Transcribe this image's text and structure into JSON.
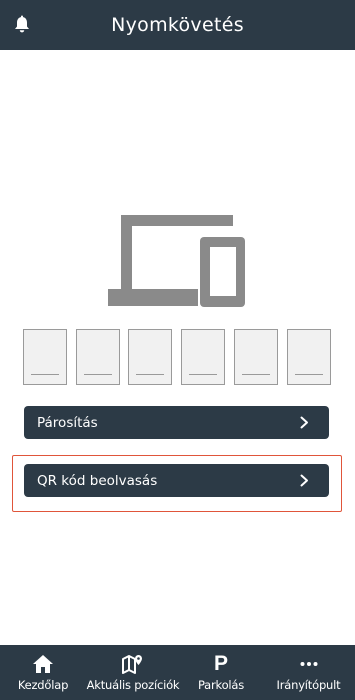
{
  "header": {
    "title": "Nyomkövetés",
    "left_icon": "bell-icon"
  },
  "main": {
    "illustration_icon": "devices-icon",
    "code_digits": [
      "",
      "",
      "",
      "",
      "",
      ""
    ],
    "buttons": [
      {
        "label": "Párosítás",
        "icon": "chevron-right-icon"
      },
      {
        "label": "QR kód beolvasás",
        "icon": "chevron-right-icon",
        "highlighted": true
      }
    ]
  },
  "bottom_nav": {
    "items": [
      {
        "label": "Kezdőlap",
        "icon": "home-icon"
      },
      {
        "label": "Aktuális pozíciók",
        "icon": "map-pin-icon"
      },
      {
        "label": "Parkolás",
        "icon": "parking-icon"
      },
      {
        "label": "Irányítópult",
        "icon": "more-dots-icon"
      }
    ]
  },
  "colors": {
    "bar_background": "#2c3a46",
    "button_background": "#2c3a46",
    "highlight_border": "#e0553a",
    "icon_gray": "#8a8a8a"
  }
}
